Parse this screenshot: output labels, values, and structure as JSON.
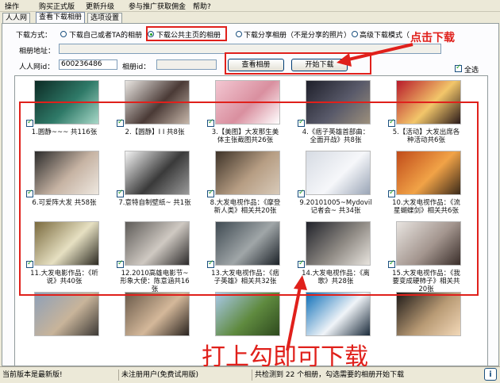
{
  "menu": {
    "items": [
      "操作",
      "购买正式版",
      "更新升级",
      "参与推广获取佣金",
      "帮助?"
    ]
  },
  "tabs": [
    "人人网",
    "查看下载相册",
    "选项设置"
  ],
  "download_mode": {
    "label": "下载方式：",
    "options": [
      "下载自己或者TA的相册",
      "下载公共主页的相册",
      "下载分享相册（不是分享的照片）",
      "高级下载模式（"
    ],
    "selected": "下载公共主页的相册"
  },
  "album_url": {
    "label": "相册地址：",
    "value": ""
  },
  "renren_id": {
    "label": "人人网id：",
    "value": "600236486"
  },
  "album_id": {
    "label": "相册id：",
    "value": ""
  },
  "buttons": {
    "view_album": "查看相册",
    "start_download": "开始下载"
  },
  "select_all": {
    "label": "全选",
    "checked": true
  },
  "annotations": {
    "click_download": "点击下载",
    "check_to_download": "打上勾即可下载"
  },
  "albums": [
    {
      "caption": "1.圆静~~~ 共116张",
      "checked": true,
      "colors": [
        "#0c2a24",
        "#2f7a68",
        "#a8d8c8"
      ]
    },
    {
      "caption": "2.【圆静】I I 共8张",
      "checked": true,
      "colors": [
        "#e9e6e2",
        "#4a3a36",
        "#c7b7aa"
      ]
    },
    {
      "caption": "3.【美图】大发那生美体主张截图共26张",
      "checked": true,
      "colors": [
        "#f3c7d2",
        "#d98f9f",
        "#ffffff"
      ]
    },
    {
      "caption": "4.《痞子英雄首部曲：全面开战》共8张",
      "checked": true,
      "colors": [
        "#1e1f2a",
        "#595a6a",
        "#9c8f7c"
      ]
    },
    {
      "caption": "5.【活动】大发出席各种活动共6张",
      "checked": true,
      "colors": [
        "#b81a2a",
        "#f2c66a",
        "#2a1a1a"
      ]
    },
    {
      "caption": "6.可爱阵大发 共58张",
      "checked": true,
      "colors": [
        "#2b2b2b",
        "#c6b3a3",
        "#eee8e0"
      ]
    },
    {
      "caption": "7.意特自制壁纸~ 共1张",
      "checked": true,
      "colors": [
        "#f4f4f4",
        "#3a3a3a",
        "#9a9a9a"
      ]
    },
    {
      "caption": "8.大发电视作品：《摩登新人类》相关共20张",
      "checked": true,
      "colors": [
        "#3e3328",
        "#b69d83",
        "#d8cab9"
      ]
    },
    {
      "caption": "9.20101005~Mydovil记者会~ 共34张",
      "checked": true,
      "colors": [
        "#d6dbe3",
        "#f6f7fa",
        "#9aa5b6"
      ]
    },
    {
      "caption": "10.大发电视作品：《流星蝴蝶剑》相关共6张",
      "checked": true,
      "colors": [
        "#c04b1a",
        "#f1a347",
        "#3b2a1a"
      ]
    },
    {
      "caption": "11.大发电影作品：《听说》共40张",
      "checked": true,
      "colors": [
        "#7a6a3e",
        "#e6e0c2",
        "#2c2a22"
      ]
    },
    {
      "caption": "12.2010高雄电影节~形象大使：陈意涵共16张",
      "checked": true,
      "colors": [
        "#5e5b58",
        "#cfc9c2",
        "#2c2a2a"
      ]
    },
    {
      "caption": "13.大发电视作品：《痞子英雄》相关共32张",
      "checked": true,
      "colors": [
        "#3f4a52",
        "#a0a6a8",
        "#1c2228"
      ]
    },
    {
      "caption": "14.大发电视作品：《离歌》共28张",
      "checked": true,
      "colors": [
        "#20222a",
        "#8f8a84",
        "#e8e4de"
      ]
    },
    {
      "caption": "15.大发电视作品：《我要变成硬柿子》相关共20张",
      "checked": true,
      "colors": [
        "#e8e4e0",
        "#a3958e",
        "#3a2e2a"
      ]
    },
    {
      "caption": "",
      "checked": false,
      "colors": [
        "#8ea0b8",
        "#c8b49a",
        "#3d3a36"
      ]
    },
    {
      "caption": "",
      "checked": false,
      "colors": [
        "#6a5a4a",
        "#d4b89a",
        "#2a2420"
      ]
    },
    {
      "caption": "",
      "checked": false,
      "colors": [
        "#a9c9e9",
        "#5f8a3f",
        "#2e4a1e"
      ]
    },
    {
      "caption": "",
      "checked": false,
      "colors": [
        "#0d6fb8",
        "#f0f4f8",
        "#1a2a3a"
      ]
    },
    {
      "caption": "",
      "checked": false,
      "colors": [
        "#1e1a18",
        "#b89a74",
        "#f2d8b8"
      ]
    }
  ],
  "status": {
    "version": "当前版本是最新版!",
    "user": "未注册用户(免费试用版)",
    "result": "共检测到 22 个相册，勾选需要的相册开始下载"
  },
  "icons": {
    "info": "info-icon"
  },
  "colors": {
    "annotation": "#e0201b",
    "check": "#21a121"
  }
}
